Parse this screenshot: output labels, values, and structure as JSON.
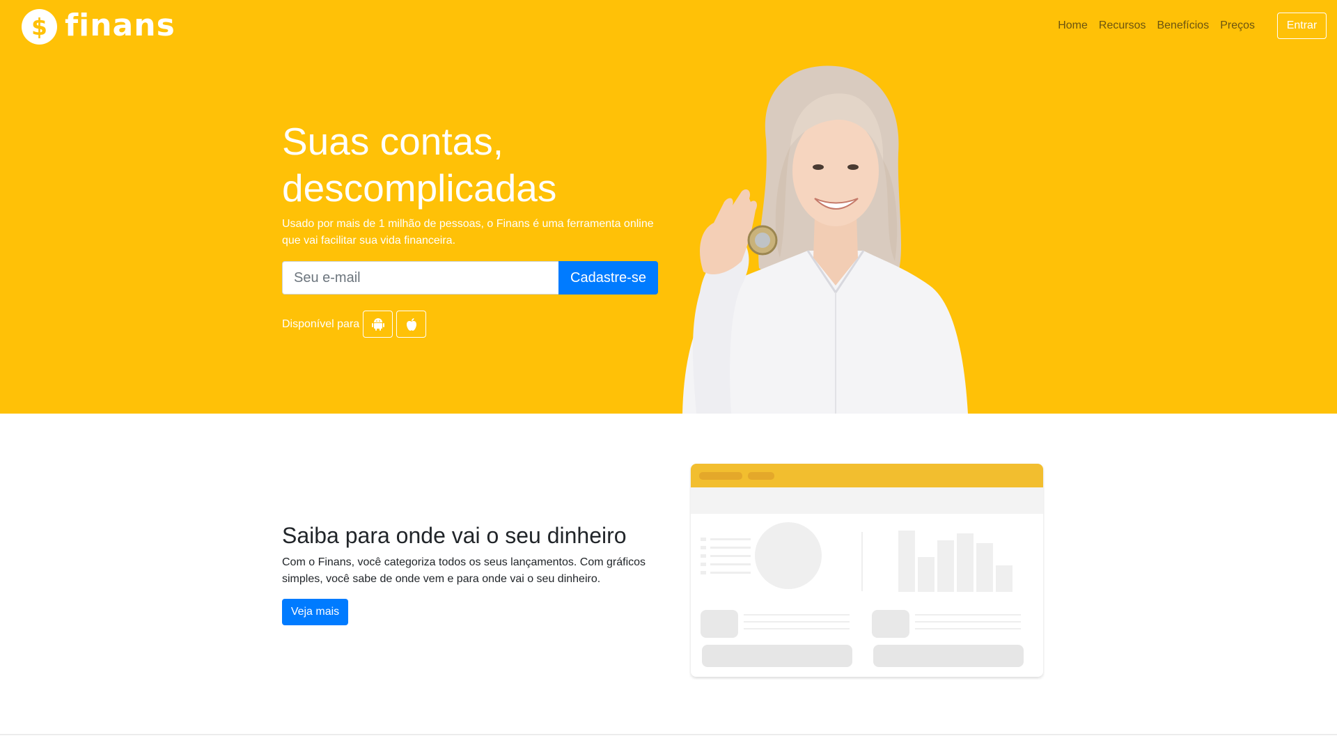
{
  "brand": {
    "name": "finans",
    "logo_symbol": "$",
    "primary_color": "#ffc107",
    "accent_color": "#007bff"
  },
  "nav": {
    "items": [
      "Home",
      "Recursos",
      "Benefícios",
      "Preços"
    ],
    "login_label": "Entrar"
  },
  "hero": {
    "title": "Suas contas, descomplicadas",
    "subtitle": "Usado por mais de 1 milhão de pessoas, o Finans é uma ferramenta online que vai facilitar sua vida financeira.",
    "email_placeholder": "Seu e-mail",
    "signup_label": "Cadastre-se",
    "available_label": "Disponível para",
    "platform_icons": [
      "android-icon",
      "apple-icon"
    ]
  },
  "feature": {
    "title": "Saiba para onde vai o seu dinheiro",
    "text": "Com o Finans, você categoriza todos os seus lançamentos. Com gráficos simples, você sabe de onde vem e para onde vai o seu dinheiro.",
    "button_label": "Veja mais"
  }
}
